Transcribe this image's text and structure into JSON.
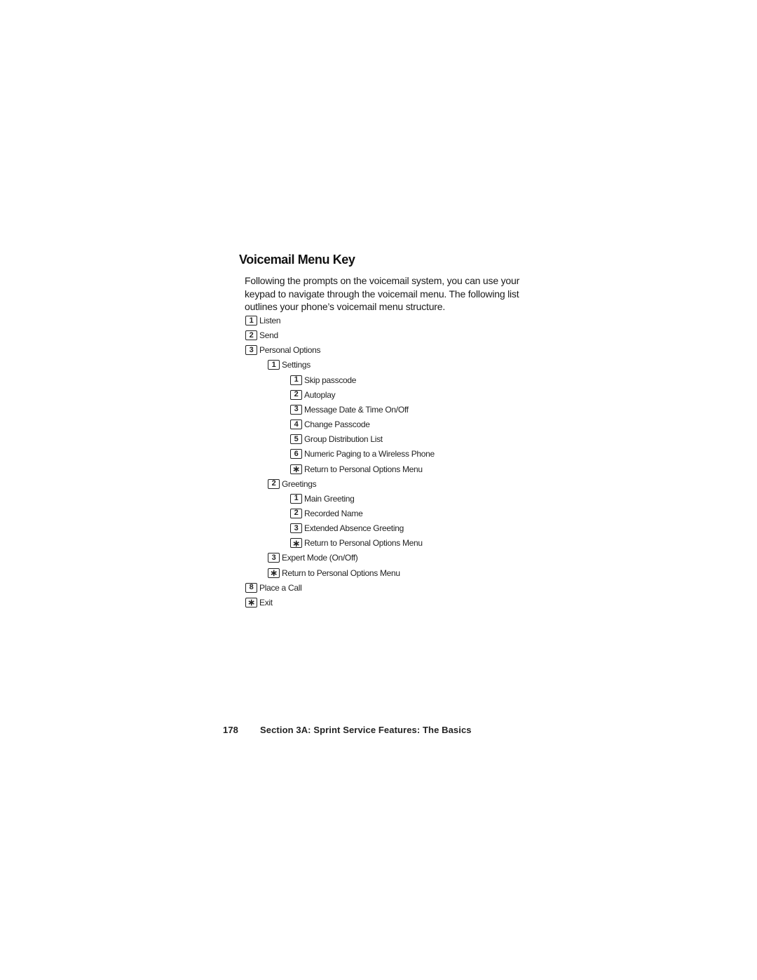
{
  "heading": "Voicemail Menu Key",
  "intro": "Following the prompts on the voicemail system, you can use your keypad to navigate through the voicemail menu. The following list outlines your phone’s voicemail menu structure.",
  "menu": [
    {
      "key": "1",
      "label": "Listen",
      "level": 0
    },
    {
      "key": "2",
      "label": "Send",
      "level": 0
    },
    {
      "key": "3",
      "label": "Personal Options",
      "level": 0
    },
    {
      "key": "1",
      "label": "Settings",
      "level": 1
    },
    {
      "key": "1",
      "label": "Skip passcode",
      "level": 2
    },
    {
      "key": "2",
      "label": "Autoplay",
      "level": 2
    },
    {
      "key": "3",
      "label": "Message Date & Time On/Off",
      "level": 2
    },
    {
      "key": "4",
      "label": "Change Passcode",
      "level": 2
    },
    {
      "key": "5",
      "label": "Group Distribution List",
      "level": 2
    },
    {
      "key": "6",
      "label": "Numeric Paging to a Wireless Phone",
      "level": 2
    },
    {
      "key": "∗",
      "label": "Return to Personal Options Menu",
      "level": 2
    },
    {
      "key": "2",
      "label": "Greetings",
      "level": 1
    },
    {
      "key": "1",
      "label": "Main Greeting",
      "level": 2
    },
    {
      "key": "2",
      "label": "Recorded Name",
      "level": 2
    },
    {
      "key": "3",
      "label": "Extended Absence Greeting",
      "level": 2
    },
    {
      "key": "∗",
      "label": "Return to Personal Options Menu",
      "level": 2
    },
    {
      "key": "3",
      "label": "Expert Mode (On/Off)",
      "level": 1
    },
    {
      "key": "∗",
      "label": "Return to Personal Options Menu",
      "level": 1
    },
    {
      "key": "8",
      "label": "Place a Call",
      "level": 0
    },
    {
      "key": "∗",
      "label": "Exit",
      "level": 0
    }
  ],
  "footer": {
    "page_number": "178",
    "section": "Section 3A: Sprint Service Features: The Basics"
  }
}
